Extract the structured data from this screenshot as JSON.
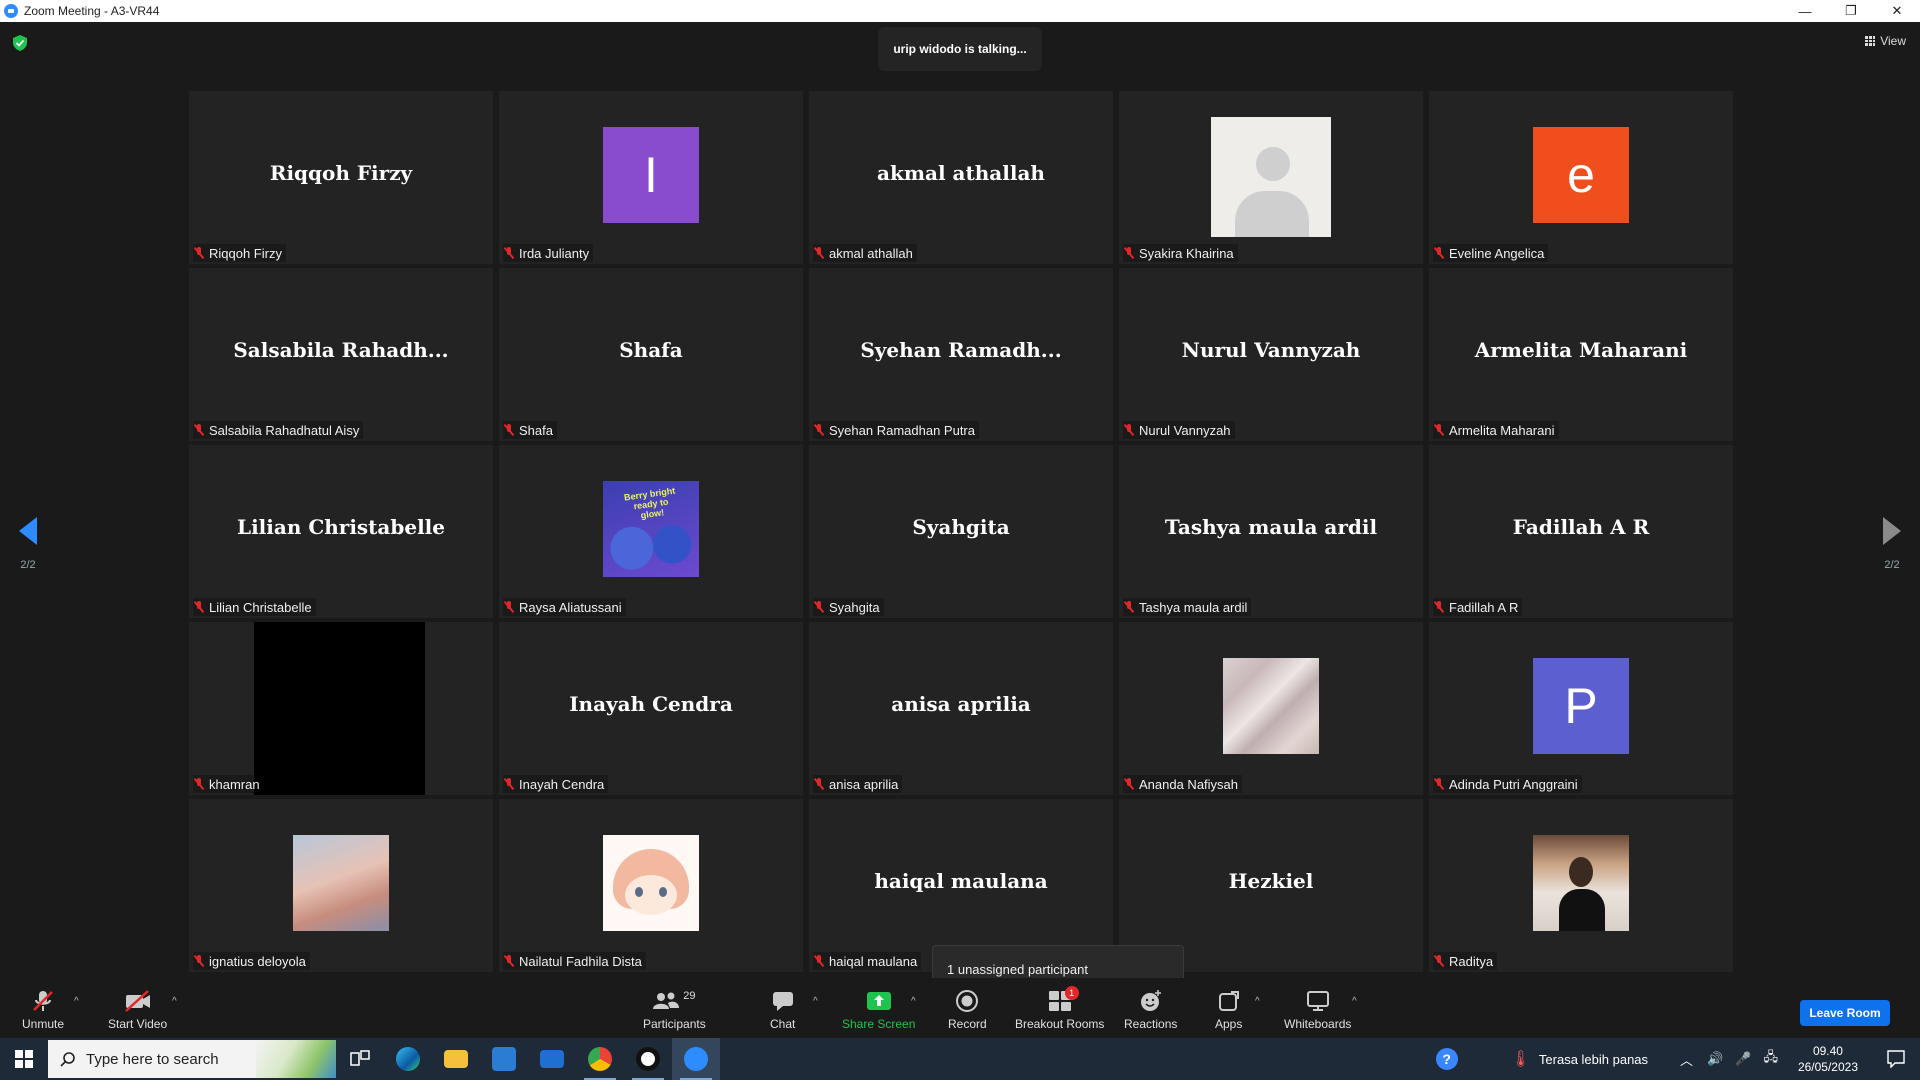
{
  "window": {
    "title": "Zoom Meeting - A3-VR44",
    "minimize": "—",
    "restore": "❐",
    "close": "✕"
  },
  "meeting": {
    "talking": "urip widodo is talking...",
    "view_label": "View",
    "page_left": "2/2",
    "page_right": "2/2",
    "unassigned": "1 unassigned participant"
  },
  "tiles": [
    {
      "big": "Riqqoh Firzy",
      "label": "Riqqoh Firzy"
    },
    {
      "avatar_letter": "I",
      "avatar_color": "#8a4ccf",
      "label": "Irda Julianty"
    },
    {
      "big": "akmal athallah",
      "label": "akmal athallah"
    },
    {
      "avatar": "person",
      "label": "Syakira Khairina"
    },
    {
      "avatar_letter": "e",
      "avatar_color": "#f04e1c",
      "label": "Eveline Angelica"
    },
    {
      "big": "Salsabila  Rahadh...",
      "label": "Salsabila Rahadhatul Aisy"
    },
    {
      "big": "Shafa",
      "label": "Shafa"
    },
    {
      "big": "Syehan  Ramadh...",
      "label": "Syehan Ramadhan Putra"
    },
    {
      "big": "Nurul Vannyzah",
      "label": "Nurul Vannyzah"
    },
    {
      "big": "Armelita Maharani",
      "label": "Armelita Maharani"
    },
    {
      "big": "Lilian Christabelle",
      "label": "Lilian Christabelle"
    },
    {
      "avatar": "photo-purple",
      "avatar_text": "Berry bright ready to glow!",
      "label": "Raysa Aliatussani"
    },
    {
      "big": "Syahgita",
      "label": "Syahgita"
    },
    {
      "big": "Tashya maula ardil",
      "label": "Tashya maula ardil"
    },
    {
      "big": "Fadillah A R",
      "label": "Fadillah A R"
    },
    {
      "avatar": "black",
      "label": "khamran"
    },
    {
      "big": "Inayah Cendra",
      "label": "Inayah Cendra"
    },
    {
      "big": "anisa aprilia",
      "label": "anisa aprilia"
    },
    {
      "avatar": "marble",
      "label": "Ananda Nafiysah"
    },
    {
      "avatar_letter": "P",
      "avatar_color": "#5b5fcf",
      "label": "Adinda Putri Anggraini"
    },
    {
      "avatar": "baby",
      "label": "ignatius deloyola"
    },
    {
      "avatar": "anime",
      "label": "Nailatul Fadhila Dista"
    },
    {
      "big": "haiqal maulana",
      "label": "haiqal maulana"
    },
    {
      "big": "Hezkiel",
      "label": ""
    },
    {
      "avatar": "boy",
      "label": "Raditya"
    }
  ],
  "toolbar": {
    "unmute": "Unmute",
    "start_video": "Start Video",
    "participants": "Participants",
    "participants_count": "29",
    "chat": "Chat",
    "share_screen": "Share Screen",
    "record": "Record",
    "breakout_rooms": "Breakout Rooms",
    "breakout_badge": "1",
    "reactions": "Reactions",
    "apps": "Apps",
    "whiteboards": "Whiteboards",
    "leave": "Leave Room"
  },
  "taskbar": {
    "search_placeholder": "Type here to search",
    "weather": "Terasa lebih panas",
    "time": "09.40",
    "date": "26/05/2023"
  },
  "colors": {
    "accent": "#2d8cff",
    "muted_red": "#e02828",
    "share_green": "#1ec44d",
    "leave_blue": "#0e72ed"
  }
}
